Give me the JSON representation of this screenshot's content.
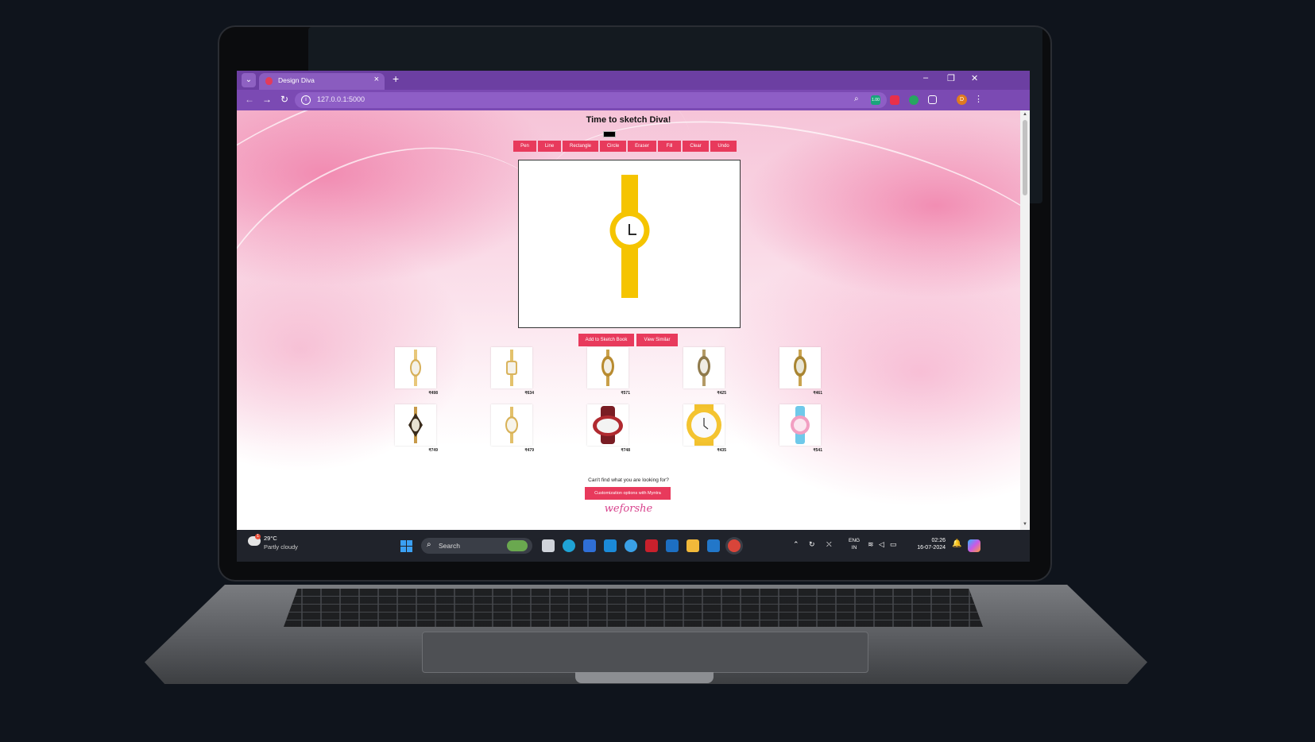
{
  "browser": {
    "tab_title": "Design Diva",
    "tab_close": "×",
    "new_tab": "+",
    "url": "127.0.0.1:5000",
    "minimize": "–",
    "restore": "❐",
    "close": "✕",
    "profile_initial": "D",
    "extension_badge": "1.00"
  },
  "page": {
    "heading": "Time to sketch Diva!",
    "stroke_color": "#000000",
    "tools": [
      "Pen",
      "Line",
      "Rectangle",
      "Circle",
      "Eraser",
      "Fill",
      "Clear",
      "Undo"
    ],
    "actions": [
      "Add to Sketch Book",
      "View Similar"
    ],
    "products": [
      {
        "price": "₹498",
        "icon": "gold-oval-watch"
      },
      {
        "price": "₹634",
        "icon": "gold-rect-watch"
      },
      {
        "price": "₹571",
        "icon": "gold-oval-watch"
      },
      {
        "price": "₹425",
        "icon": "gold-oval-watch"
      },
      {
        "price": "₹461",
        "icon": "gold-oval-watch"
      },
      {
        "price": "₹749",
        "icon": "gold-black-watch"
      },
      {
        "price": "₹479",
        "icon": "gold-oval-watch"
      },
      {
        "price": "₹748",
        "icon": "red-oval-watch"
      },
      {
        "price": "₹435",
        "icon": "yellow-round-watch"
      },
      {
        "price": "₹541",
        "icon": "pink-blue-watch"
      }
    ],
    "cant_find": "Can't find what you are looking for?",
    "custom_button": "Customization options with Myntra",
    "logo_text": "weforshe",
    "colors": {
      "accent": "#e83a5c",
      "tab_bar": "#6c3fa2",
      "address_bar": "#7b4ab3",
      "sketch_watch": "#f5c400"
    }
  },
  "taskbar": {
    "temperature": "29°C",
    "weather": "Partly cloudy",
    "weather_badge": "1",
    "search_label": "Search",
    "language": "ENG",
    "region": "IN",
    "time": "02:26",
    "date": "16-07-2024"
  }
}
